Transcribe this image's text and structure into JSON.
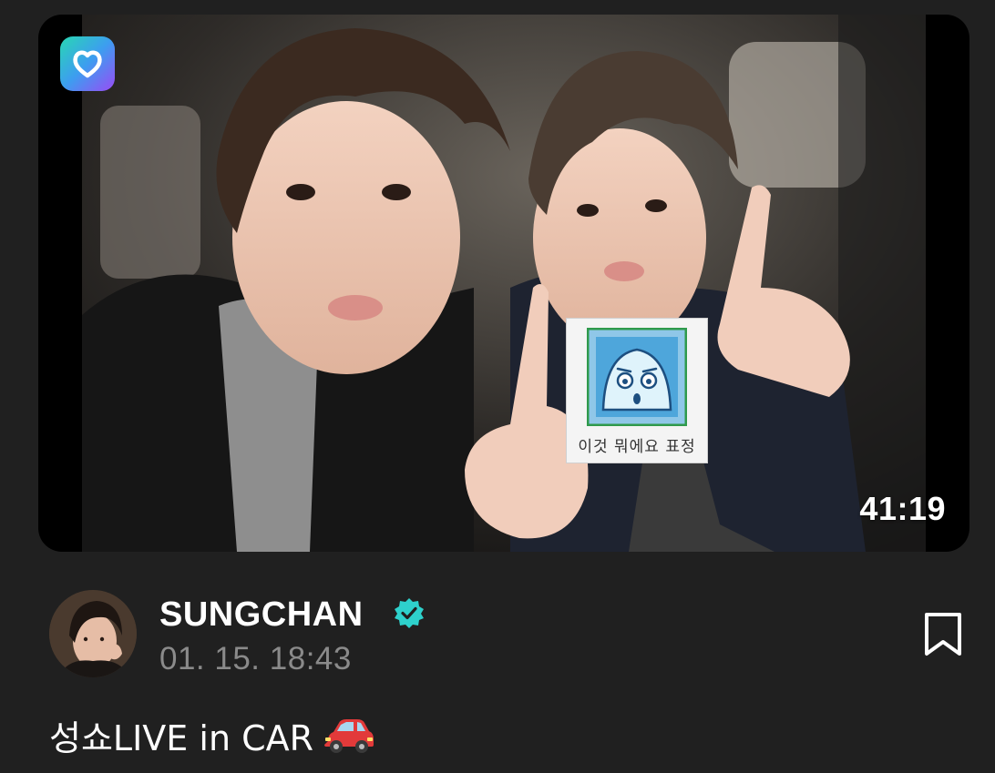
{
  "video": {
    "duration": "41:19",
    "app_logo_icon": "heart-app-logo-icon",
    "sticker_caption": "이것 뭐에요 표정"
  },
  "post": {
    "author": "SUNGCHAN",
    "verified_icon": "verified-badge-icon",
    "timestamp": "01. 15. 18:43",
    "title": "성쇼LIVE in CAR",
    "title_emoji_icon": "red-car-icon",
    "bookmark_icon": "bookmark-icon"
  },
  "colors": {
    "background": "#202020",
    "verified": "#2ed1cc",
    "meta_text": "#8a8a8a",
    "accent_gradient_start": "#28d7b3",
    "accent_gradient_end": "#9a4bf5"
  }
}
